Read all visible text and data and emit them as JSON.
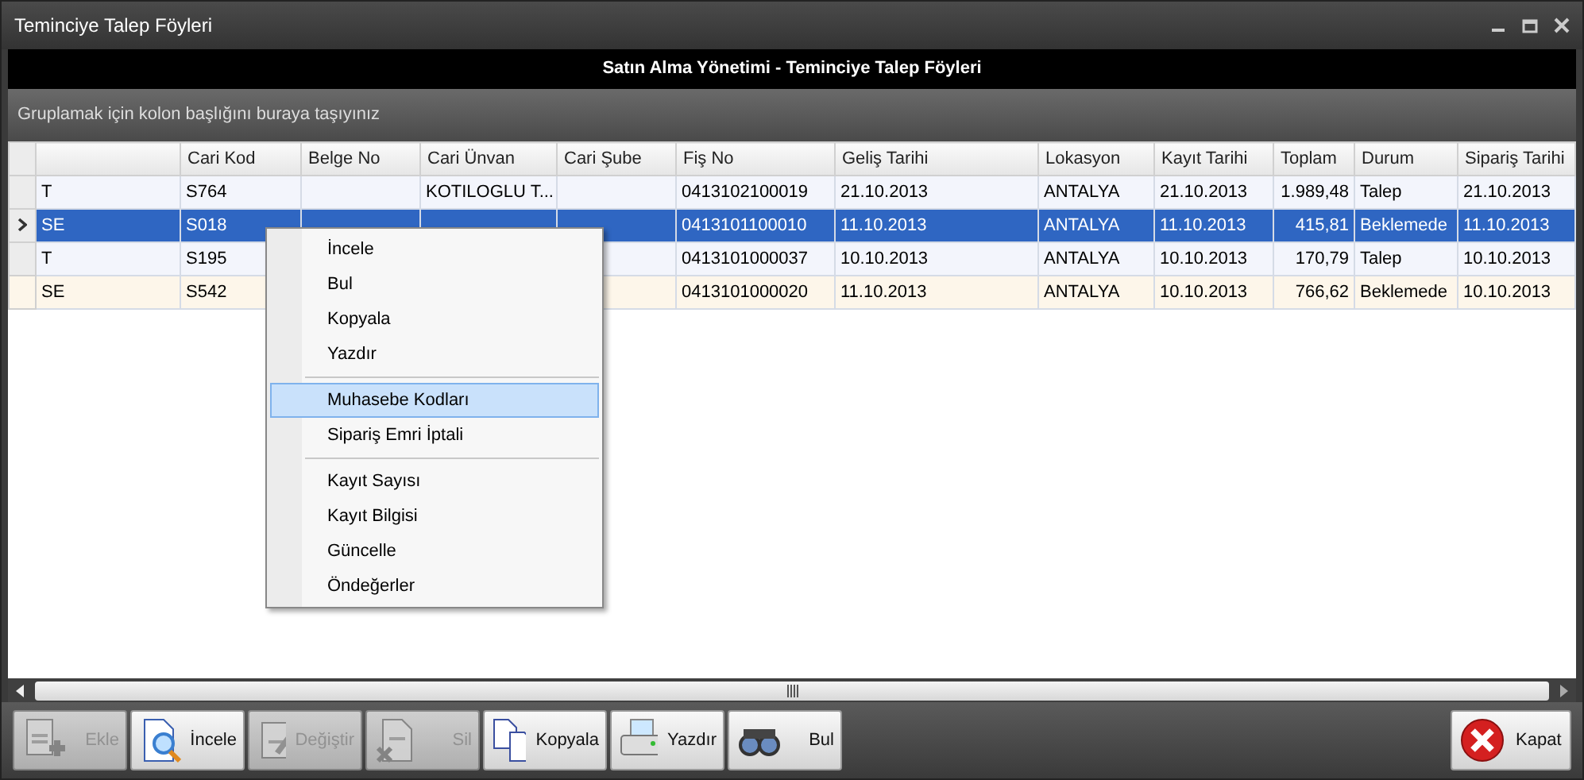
{
  "window": {
    "title": "Teminciye Talep Föyleri"
  },
  "header": "Satın Alma Yönetimi - Teminciye Talep Föyleri",
  "group_panel": "Gruplamak için kolon başlığını buraya taşıyınız",
  "table": {
    "columns": [
      null,
      "Cari Kod",
      "Belge No",
      "Cari Ünvan",
      "Cari Şube",
      "Fiş No",
      "Geliş Tarihi",
      "Lokasyon",
      "Kayıt Tarihi",
      "Toplam",
      "Durum",
      "Sipariş Tarihi"
    ],
    "rows": [
      {
        "selected": false,
        "tinted": false,
        "cells": [
          "T",
          "S764",
          null,
          "KOTILOGLU T...",
          null,
          "0413102100019",
          "21.10.2013",
          "ANTALYA",
          "21.10.2013",
          "1.989,48",
          "Talep",
          "21.10.2013"
        ]
      },
      {
        "selected": true,
        "tinted": false,
        "cells": [
          "SE",
          "S018",
          null,
          null,
          null,
          "0413101100010",
          "11.10.2013",
          "ANTALYA",
          "11.10.2013",
          "415,81",
          "Beklemede",
          "11.10.2013"
        ]
      },
      {
        "selected": false,
        "tinted": false,
        "cells": [
          "T",
          "S195",
          null,
          null,
          null,
          "0413101000037",
          "10.10.2013",
          "ANTALYA",
          "10.10.2013",
          "170,79",
          "Talep",
          "10.10.2013"
        ]
      },
      {
        "selected": false,
        "tinted": true,
        "cells": [
          "SE",
          "S542",
          null,
          null,
          null,
          "0413101000020",
          "11.10.2013",
          "ANTALYA",
          "10.10.2013",
          "766,62",
          "Beklemede",
          "10.10.2013"
        ]
      }
    ]
  },
  "context_menu": [
    {
      "kind": "item",
      "label": "İncele",
      "selected": false
    },
    {
      "kind": "item",
      "label": "Bul",
      "selected": false
    },
    {
      "kind": "item",
      "label": "Kopyala",
      "selected": false
    },
    {
      "kind": "item",
      "label": "Yazdır",
      "selected": false
    },
    {
      "kind": "separator"
    },
    {
      "kind": "item",
      "label": "Muhasebe Kodları",
      "selected": true
    },
    {
      "kind": "item",
      "label": "Sipariş Emri İptali",
      "selected": false
    },
    {
      "kind": "separator"
    },
    {
      "kind": "item",
      "label": "Kayıt Sayısı",
      "selected": false
    },
    {
      "kind": "item",
      "label": "Kayıt Bilgisi",
      "selected": false
    },
    {
      "kind": "item",
      "label": "Güncelle",
      "selected": false
    },
    {
      "kind": "item",
      "label": "Öndeğerler",
      "selected": false
    }
  ],
  "toolbar": [
    {
      "kind": "add",
      "label": "Ekle",
      "disabled": true
    },
    {
      "kind": "inspect",
      "label": "İncele",
      "disabled": false
    },
    {
      "kind": "edit",
      "label": "Değiştir",
      "disabled": true
    },
    {
      "kind": "delete",
      "label": "Sil",
      "disabled": true
    },
    {
      "kind": "copy",
      "label": "Kopyala",
      "disabled": false
    },
    {
      "kind": "print",
      "label": "Yazdır",
      "disabled": false
    },
    {
      "kind": "find",
      "label": "Bul",
      "disabled": false
    }
  ],
  "close_button": {
    "label": "Kapat"
  }
}
